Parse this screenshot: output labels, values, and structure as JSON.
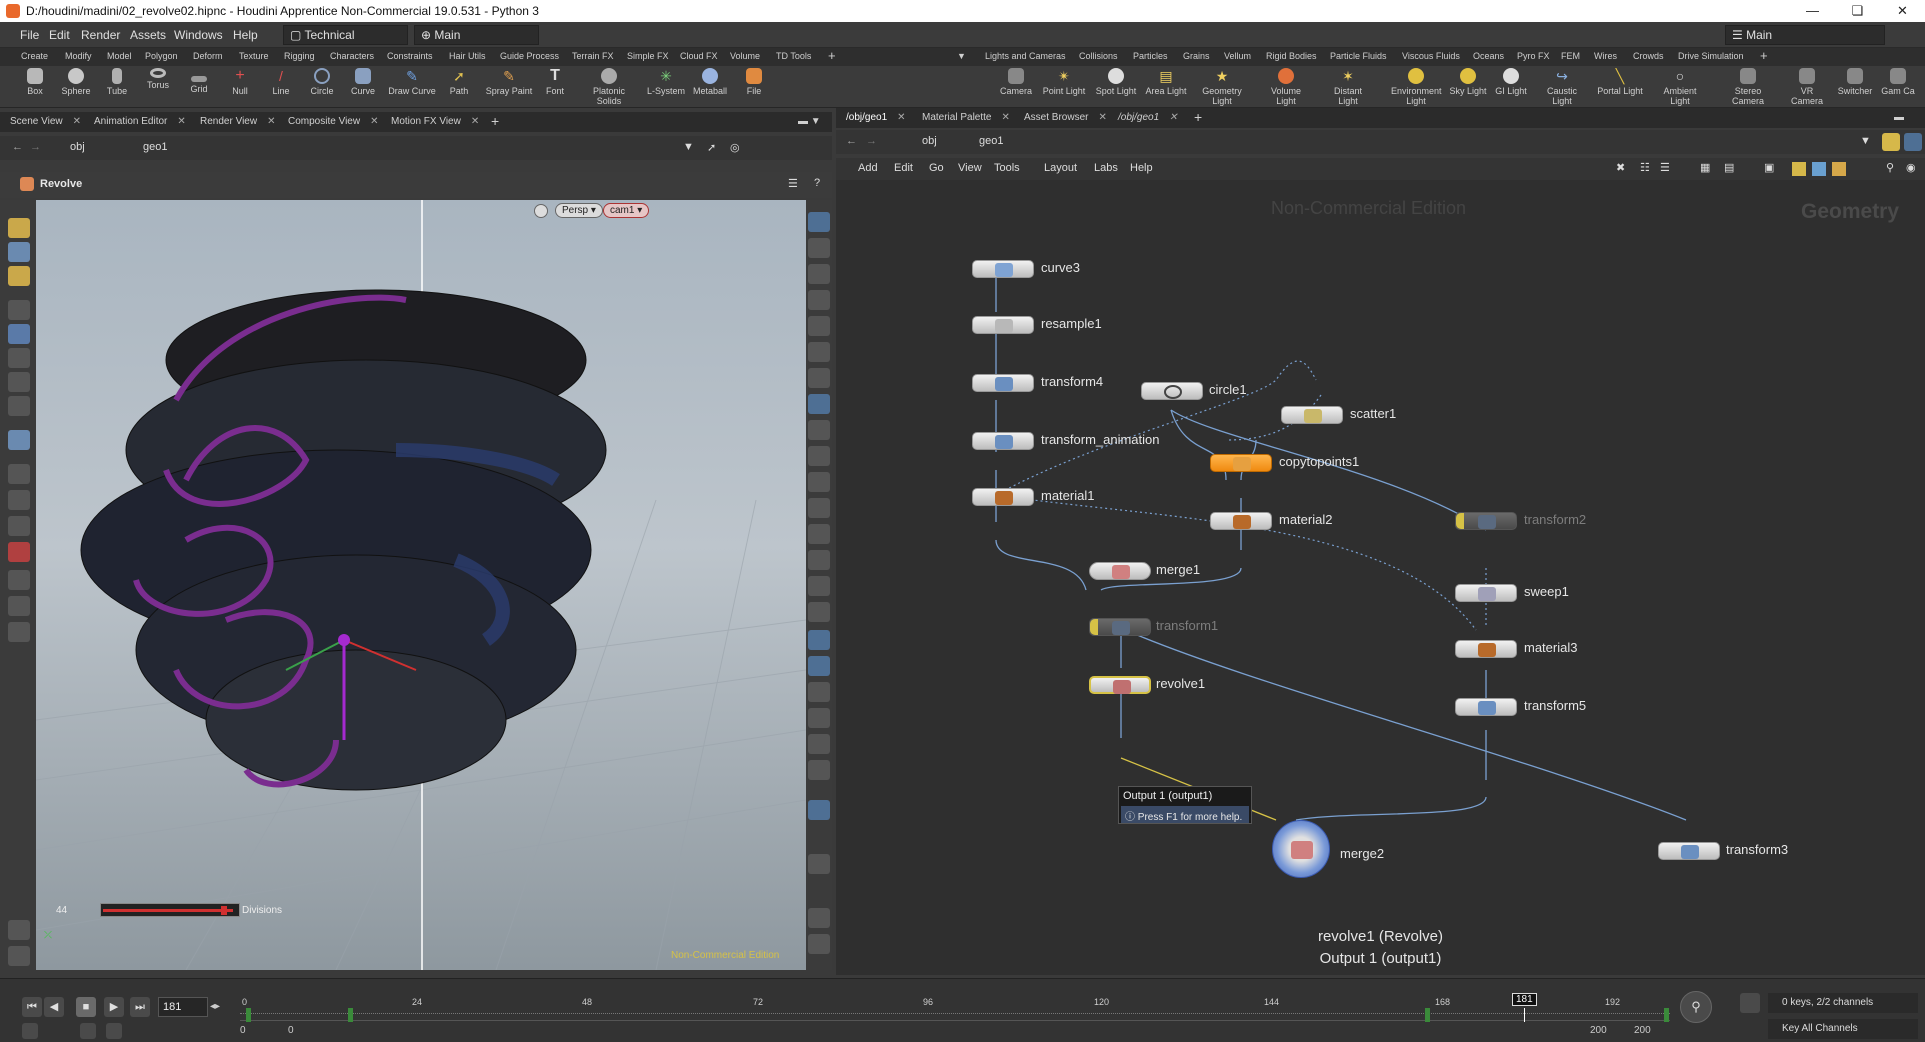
{
  "window": {
    "title": "D:/houdini/madini/02_revolve02.hipnc - Houdini Apprentice Non-Commercial 19.0.531 - Python 3"
  },
  "menu": {
    "items": [
      "File",
      "Edit",
      "Render",
      "Assets",
      "Windows",
      "Help"
    ],
    "desktop": "Technical",
    "main": "Main",
    "right_main": "Main"
  },
  "shelf_left": {
    "tabs": [
      "Create",
      "Modify",
      "Model",
      "Polygon",
      "Deform",
      "Texture",
      "Rigging",
      "Characters",
      "Constraints",
      "Hair Utils",
      "Guide Process",
      "Terrain FX",
      "Simple FX",
      "Cloud FX",
      "Volume",
      "TD Tools"
    ],
    "tools": [
      "Box",
      "Sphere",
      "Tube",
      "Torus",
      "Grid",
      "Null",
      "Line",
      "Circle",
      "Curve",
      "Draw Curve",
      "Path",
      "Spray Paint",
      "Font",
      "Platonic Solids",
      "L-System",
      "Metaball",
      "File"
    ]
  },
  "shelf_right": {
    "tabs": [
      "Lights and Cameras",
      "Collisions",
      "Particles",
      "Grains",
      "Vellum",
      "Rigid Bodies",
      "Particle Fluids",
      "Viscous Fluids",
      "Oceans",
      "Pyro FX",
      "FEM",
      "Wires",
      "Crowds",
      "Drive Simulation"
    ],
    "tools": [
      "Camera",
      "Point Light",
      "Spot Light",
      "Area Light",
      "Geometry Light",
      "Volume Light",
      "Distant Light",
      "Environment Light",
      "Sky Light",
      "GI Light",
      "Caustic Light",
      "Portal Light",
      "Ambient Light",
      "Stereo Camera",
      "VR Camera",
      "Switcher",
      "Gam Ca"
    ]
  },
  "left_pane": {
    "tabs": [
      "Scene View",
      "Animation Editor",
      "Render View",
      "Composite View",
      "Motion FX View"
    ],
    "path": [
      "obj",
      "geo1"
    ],
    "tool_title": "Revolve",
    "persp": "Persp",
    "cam": "cam1",
    "divisions_value": "44",
    "divisions_label": "Divisions",
    "watermark": "Non-Commercial Edition"
  },
  "right_pane": {
    "tabs": [
      "/obj/geo1",
      "Material Palette",
      "Asset Browser",
      "/obj/geo1"
    ],
    "path": [
      "obj",
      "geo1"
    ],
    "menu": [
      "Add",
      "Edit",
      "Go",
      "View",
      "Tools",
      "Layout",
      "Labs",
      "Help"
    ],
    "watermark": "Non-Commercial Edition",
    "context": "Geometry",
    "nodes": [
      {
        "name": "curve3"
      },
      {
        "name": "resample1"
      },
      {
        "name": "transform4"
      },
      {
        "name": "transform_animation"
      },
      {
        "name": "material1"
      },
      {
        "name": "circle1"
      },
      {
        "name": "scatter1"
      },
      {
        "name": "copytopoints1"
      },
      {
        "name": "material2"
      },
      {
        "name": "transform2"
      },
      {
        "name": "merge1"
      },
      {
        "name": "sweep1"
      },
      {
        "name": "transform1"
      },
      {
        "name": "material3"
      },
      {
        "name": "revolve1"
      },
      {
        "name": "transform5"
      },
      {
        "name": "merge2"
      },
      {
        "name": "transform3"
      }
    ],
    "tooltip": {
      "line1": "Output 1 (output1)",
      "line2": "Press F1 for more help."
    },
    "footer": {
      "line1": "revolve1 (Revolve)",
      "line2": "Output 1 (output1)"
    }
  },
  "timeline": {
    "frame": "181",
    "ticks": [
      "0",
      "24",
      "48",
      "72",
      "96",
      "120",
      "144",
      "168",
      "192"
    ],
    "current_marker": "181",
    "start": "0",
    "start2": "0",
    "end": "200",
    "end2": "200",
    "keys_info": "0 keys, 2/2 channels",
    "key_all": "Key All Channels"
  }
}
